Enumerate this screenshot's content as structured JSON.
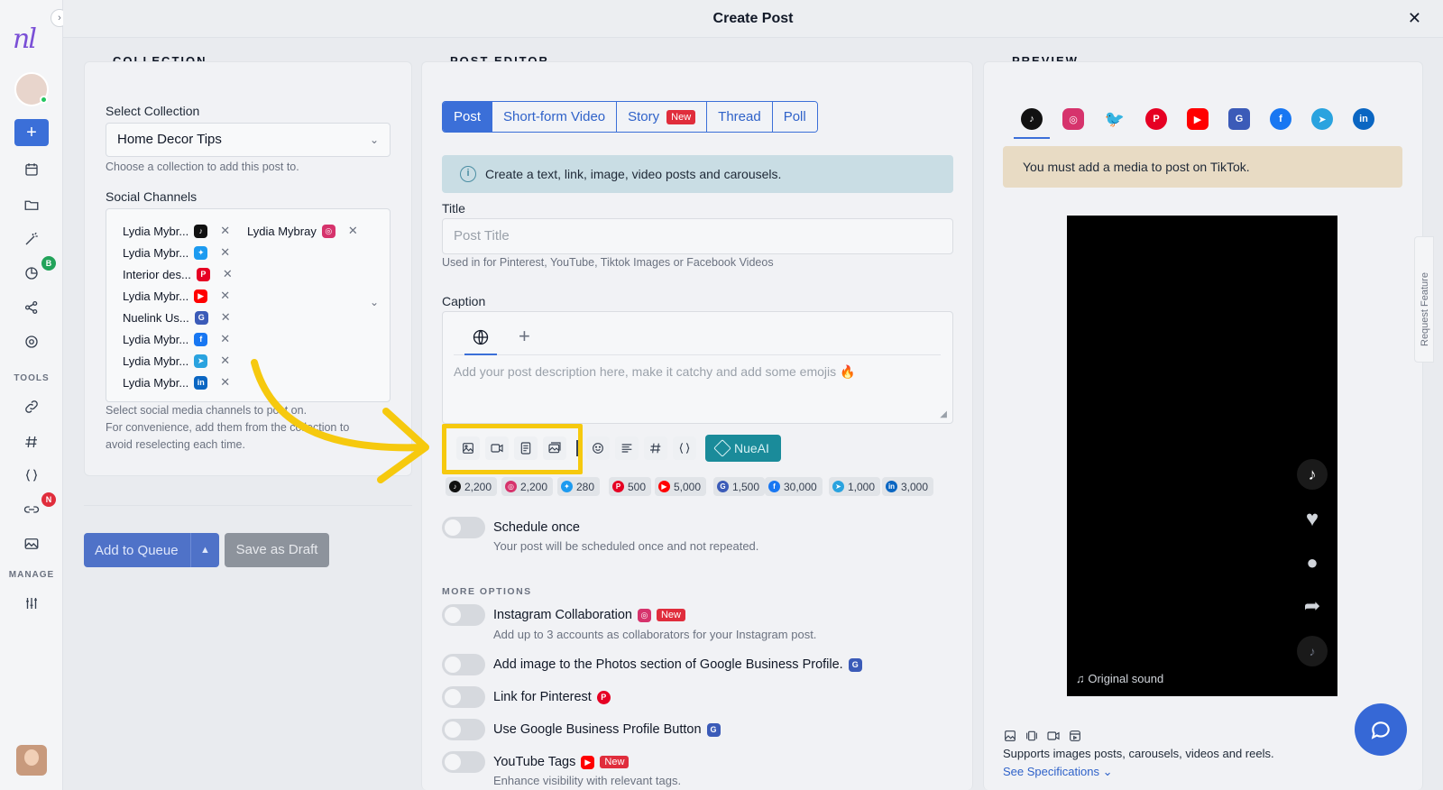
{
  "app": {
    "logo_text": "nl",
    "modal_title": "Create Post",
    "close_label": "✕",
    "collapse_label": "›"
  },
  "rail": {
    "tools_label": "TOOLS",
    "manage_label": "MANAGE",
    "analytics_badge": "B",
    "links_badge": "N"
  },
  "collection": {
    "section_title": "COLLECTION",
    "select_label": "Select Collection",
    "selected": "Home Decor Tips",
    "select_hint": "Choose a collection to add this post to.",
    "channels_label": "Social Channels",
    "channels": [
      {
        "name": "Lydia Mybr...",
        "network": "tiktok"
      },
      {
        "name": "Lydia Mybray",
        "network": "instagram"
      },
      {
        "name": "Lydia Mybr...",
        "network": "twitter"
      },
      {
        "name": "Interior des...",
        "network": "pinterest"
      },
      {
        "name": "Lydia Mybr...",
        "network": "youtube"
      },
      {
        "name": "Nuelink Us...",
        "network": "google-business"
      },
      {
        "name": "Lydia Mybr...",
        "network": "facebook"
      },
      {
        "name": "Lydia Mybr...",
        "network": "telegram"
      },
      {
        "name": "Lydia Mybr...",
        "network": "linkedin"
      }
    ],
    "channels_hint_1": "Select social media channels to post on.",
    "channels_hint_2": "For convenience, add them from the collection to",
    "channels_hint_3": "avoid reselecting each time.",
    "queue_label": "Add to Queue",
    "draft_label": "Save as Draft"
  },
  "editor": {
    "section_title": "POST EDITOR",
    "tabs": [
      "Post",
      "Short-form Video",
      "Story",
      "Thread",
      "Poll"
    ],
    "new_badge": "New",
    "info_text": "Create a text, link, image, video posts and carousels.",
    "title_label": "Title",
    "title_placeholder": "Post Title",
    "title_hint": "Used in for Pinterest, YouTube, Tiktok Images or Facebook Videos",
    "caption_label": "Caption",
    "caption_placeholder": "Add your post description here, make it catchy and add some emojis 🔥",
    "nueai_label": "NueAI",
    "limits": [
      {
        "network": "tiktok",
        "value": "2,200"
      },
      {
        "network": "instagram",
        "value": "2,200"
      },
      {
        "network": "twitter",
        "value": "280"
      },
      {
        "network": "pinterest",
        "value": "500"
      },
      {
        "network": "youtube",
        "value": "5,000"
      },
      {
        "network": "google-business",
        "value": "1,500"
      },
      {
        "network": "facebook",
        "value": "30,000"
      },
      {
        "network": "telegram",
        "value": "1,000"
      },
      {
        "network": "linkedin",
        "value": "3,000"
      }
    ],
    "schedule_title": "Schedule once",
    "schedule_desc": "Your post will be scheduled once and not repeated.",
    "more_options": "MORE OPTIONS",
    "options": [
      {
        "title": "Instagram Collaboration",
        "desc": "Add up to 3 accounts as collaborators for your Instagram post."
      },
      {
        "title": "Add image to the Photos section of Google Business Profile.",
        "desc": ""
      },
      {
        "title": "Link for Pinterest",
        "desc": ""
      },
      {
        "title": "Use Google Business Profile Button",
        "desc": ""
      },
      {
        "title": "YouTube Tags",
        "desc": "Enhance visibility with relevant tags."
      }
    ]
  },
  "preview": {
    "section_title": "PREVIEW",
    "warning": "You must add a media to post on TikTok.",
    "sound_label": "♫ Original sound",
    "supports_text": "Supports images posts, carousels, videos and reels.",
    "spec_link": "See Specifications ⌄",
    "request_feature": "Request Feature"
  },
  "colors": {
    "tiktok": "#111111",
    "instagram": "#d6336c",
    "twitter": "#1d9bf0",
    "pinterest": "#e60023",
    "youtube": "#ff0000",
    "google-business": "#3b5bb8",
    "facebook": "#1877f2",
    "telegram": "#2aa3df",
    "linkedin": "#0a66c2",
    "accent": "#3b6fd8",
    "highlight": "#f6c90e"
  }
}
